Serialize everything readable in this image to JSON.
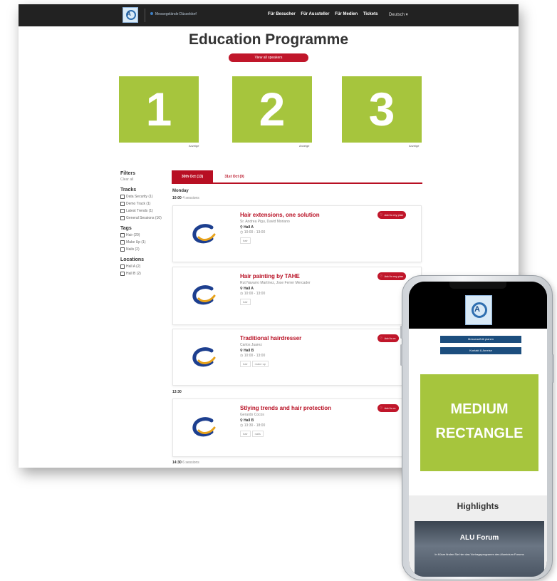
{
  "nav": {
    "tagline": "Messegelände Düsseldorf",
    "links": [
      "Für Besucher",
      "Für Aussteller",
      "Für Medien",
      "Tickets"
    ],
    "language": "Deutsch ▾"
  },
  "page": {
    "title": "Education Programme",
    "view_speakers": "View all speakers"
  },
  "ads": [
    {
      "number": "1",
      "caption": "Anzeige"
    },
    {
      "number": "2",
      "caption": "Anzeige"
    },
    {
      "number": "3",
      "caption": "Anzeige"
    }
  ],
  "filters": {
    "title": "Filters",
    "clear": "Clear all",
    "tracks_heading": "Tracks",
    "tracks": [
      "Data Security (1)",
      "Demo Track (1)",
      "Latest Trends (1)",
      "General Sessions (10)"
    ],
    "tags_heading": "Tags",
    "tags": [
      "Hair (20)",
      "Make Up (1)",
      "Nails (2)"
    ],
    "locations_heading": "Locations",
    "locations": [
      "Hall A (2)",
      "Hall B (2)"
    ]
  },
  "tabs": [
    "30th Oct (13)",
    "31st Oct (0)"
  ],
  "schedule": {
    "day": "Monday",
    "slot1_time": "10:00",
    "slot1_count": "4 sessions",
    "slot2_time": "13:30",
    "slot3_time": "14:30",
    "slot3_count": "6 sessions",
    "add_label": "Add to my plan",
    "add_label_short": "Add to m",
    "sessions": [
      {
        "title": "Hair extensions, one solution",
        "speakers": "Sr. Andrea Pigu, David Moriano",
        "hall": "Hall A",
        "time": "10:00 - 13:00",
        "tags": [
          "hair"
        ]
      },
      {
        "title": "Hair painting by TAHE",
        "speakers": "Rut Navarro Martínez, Jose Ferrer Mercader",
        "hall": "Hall A",
        "time": "10:00 - 13:00",
        "tags": [
          "hair"
        ]
      },
      {
        "title": "Traditional hairdresser",
        "speakers": "Carlos Juarez",
        "hall": "Hall B",
        "time": "10:00 - 13:00",
        "tags": [
          "hair",
          "make up"
        ]
      },
      {
        "title": "Stlying trends and hair protection",
        "speakers": "Gerardo Cocos",
        "hall": "Hall B",
        "time": "13:30 - 18:00",
        "tags": [
          "hair",
          "nails"
        ]
      }
    ]
  },
  "mobile": {
    "btn1": "Messeauftritt planen",
    "btn2": "Kontakt & Anreise",
    "medium_line1": "MEDIUM",
    "medium_line2": "RECTANGLE",
    "highlights": "Highlights",
    "alu_title": "ALU Forum",
    "alu_text": "In Kürze finden Sie hier das Vortragsprogramm des Aluminium Forums"
  },
  "colors": {
    "brand_red": "#c0162a",
    "ad_green": "#a6c53d",
    "nav_dark": "#222222",
    "mobile_blue": "#1c4e7e"
  }
}
